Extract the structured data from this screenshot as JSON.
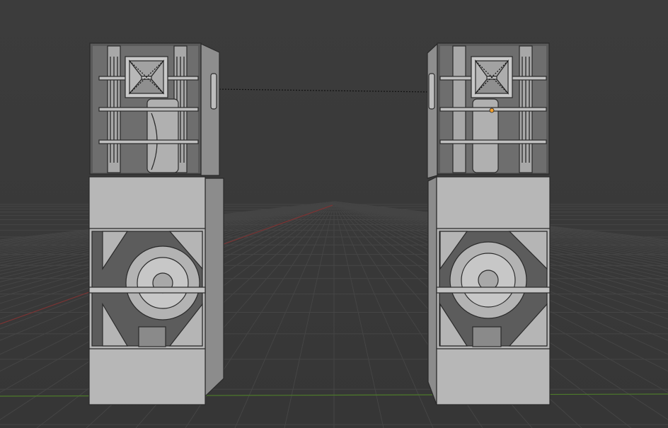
{
  "viewport": {
    "background": "#3a3a3a",
    "grid_color": "#454545",
    "x_axis_color": "#8a3a3a",
    "y_axis_color": "#4e7a2a",
    "model_color": "#b5b5b5",
    "model_shadow": "#9a9a9a",
    "model_edge": "#2a2a2a",
    "selection_color": "#f0a030"
  },
  "objects": [
    {
      "name": "speaker-left",
      "parts": [
        "top-cabinet",
        "horn",
        "sub-cabinet",
        "woofer"
      ]
    },
    {
      "name": "speaker-right",
      "parts": [
        "top-cabinet",
        "horn",
        "sub-cabinet",
        "woofer"
      ]
    }
  ]
}
